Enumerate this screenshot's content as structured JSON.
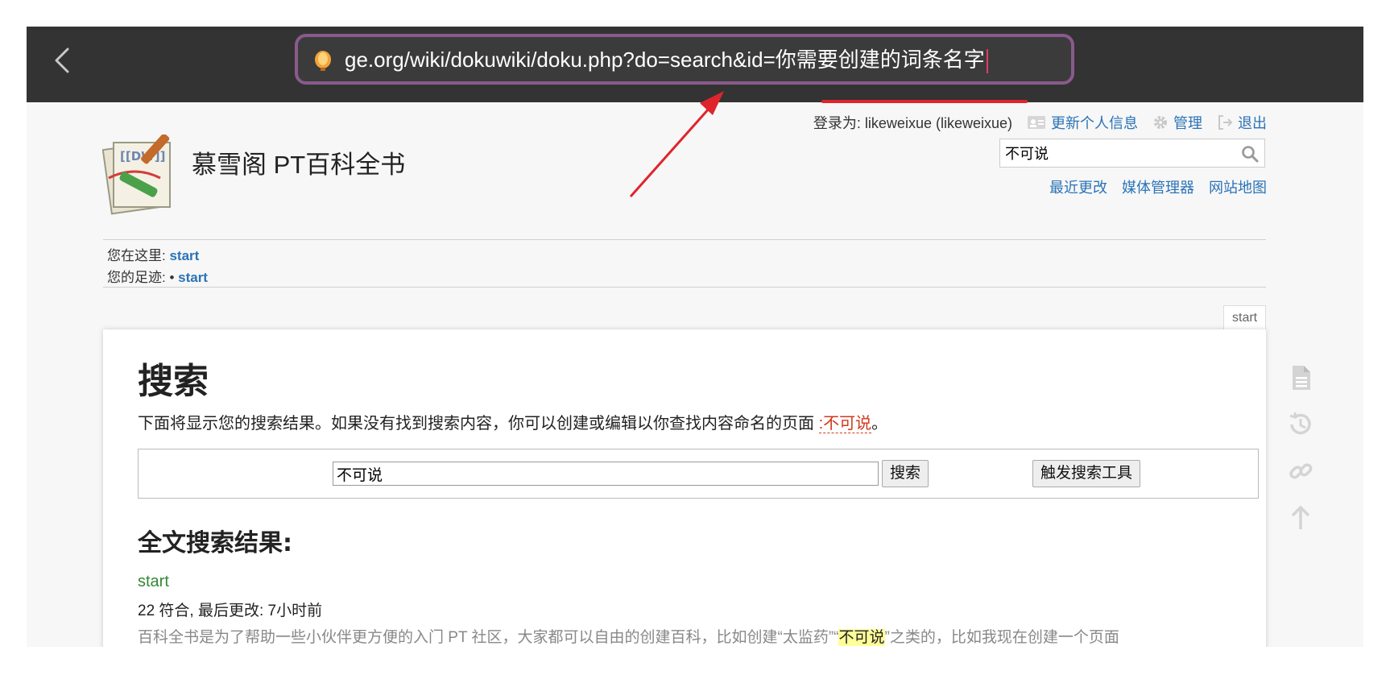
{
  "browser": {
    "url": "ge.org/wiki/dokuwiki/doku.php?do=search&id=你需要创建的词条名字"
  },
  "userbar": {
    "logged_in_text": "登录为: likeweixue (likeweixue)",
    "profile_link": "更新个人信息",
    "admin_link": "管理",
    "logout_link": "退出"
  },
  "site": {
    "title": "慕雪阁 PT百科全书",
    "logo_text": "[[DW]]"
  },
  "quick_search": {
    "value": "不可说"
  },
  "toolbar": {
    "recent": "最近更改",
    "media": "媒体管理器",
    "sitemap": "网站地图"
  },
  "breadcrumbs": {
    "here_label": "您在这里: ",
    "here_link": "start",
    "trace_label": "您的足迹: • ",
    "trace_link": "start"
  },
  "page_tab": "start",
  "content": {
    "heading": "搜索",
    "intro_prefix": "下面将显示您的搜索结果。如果没有找到搜索内容，你可以创建或编辑以你查找内容命名的页面 ",
    "intro_link": ":不可说",
    "intro_suffix": "。",
    "search_value": "不可说",
    "search_button": "搜索",
    "advanced_button": "触发搜索工具",
    "results_heading": "全文搜索结果:",
    "result_title": "start",
    "result_meta": "22 符合, 最后更改: 7小时前",
    "snippet_before": "百科全书是为了帮助一些小伙伴更方便的入门 PT 社区，大家都可以自由的创建百科，比如创建“太监药”“",
    "snippet_highlight": "不可说",
    "snippet_after": "”之类的，比如我现在创建一个页面"
  },
  "icons": [
    "back-icon",
    "lantern-icon",
    "profile-icon",
    "gear-icon",
    "logout-icon",
    "search-icon",
    "page-icon",
    "history-icon",
    "link-icon",
    "arrow-up-icon"
  ],
  "colors": {
    "topbar": "#333333",
    "url_border": "#8a5a8c",
    "annotation": "#e0242c",
    "link": "#2b73b7",
    "missing_link": "#d0391d",
    "result_link": "#338833",
    "highlight": "#ffff99"
  }
}
